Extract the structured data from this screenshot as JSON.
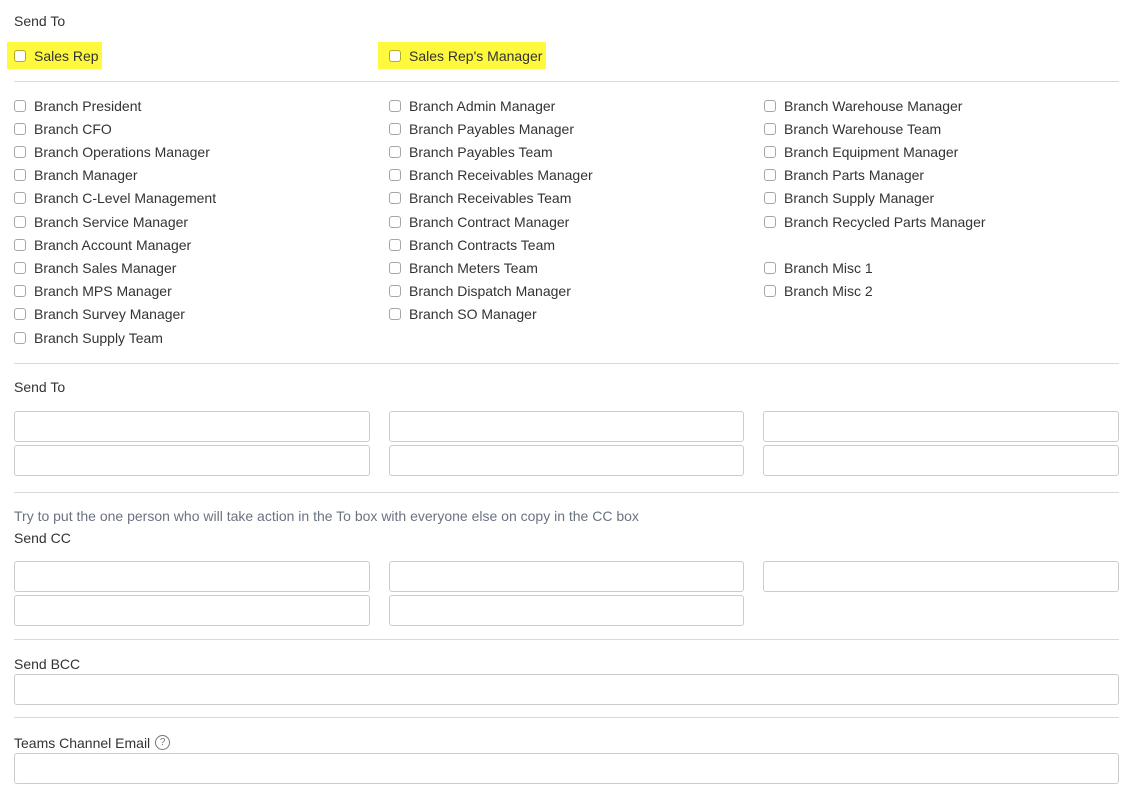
{
  "send_to_header": "Send To",
  "top_options": [
    {
      "label": "Sales Rep",
      "checked": false,
      "highlight": "#fff93d"
    },
    {
      "label": "Sales Rep's Manager",
      "checked": false,
      "highlight": "#fff93d"
    }
  ],
  "branch_columns": [
    [
      "Branch President",
      "Branch CFO",
      "Branch Operations Manager",
      "Branch Manager",
      "Branch C-Level Management",
      "Branch Service Manager",
      "Branch Account Manager",
      "Branch Sales Manager",
      "Branch MPS Manager",
      "Branch Survey Manager",
      "Branch Supply Team"
    ],
    [
      "Branch Admin Manager",
      "Branch Payables Manager",
      "Branch Payables Team",
      "Branch Receivables Manager",
      "Branch Receivables Team",
      "Branch Contract Manager",
      "Branch Contracts Team",
      "Branch Meters Team",
      "Branch Dispatch Manager",
      "Branch SO Manager"
    ],
    [
      "Branch Warehouse Manager",
      "Branch Warehouse Team",
      "Branch Equipment Manager",
      "Branch Parts Manager",
      "Branch Supply Manager",
      "Branch Recycled Parts Manager",
      "",
      "Branch Misc 1",
      "Branch Misc 2"
    ]
  ],
  "send_to_fields_label": "Send To",
  "cc_hint": "Try to put the one person who will take action in the To box with everyone else on copy in the CC box",
  "send_cc_label": "Send CC",
  "send_bcc_label": "Send BCC",
  "teams_label": "Teams Channel Email",
  "help_glyph": "?",
  "colors": {
    "highlight": "#fff93d",
    "border": "#cccccc",
    "divider": "#d9d9d9",
    "text": "#333333",
    "hint": "#6b7280"
  }
}
